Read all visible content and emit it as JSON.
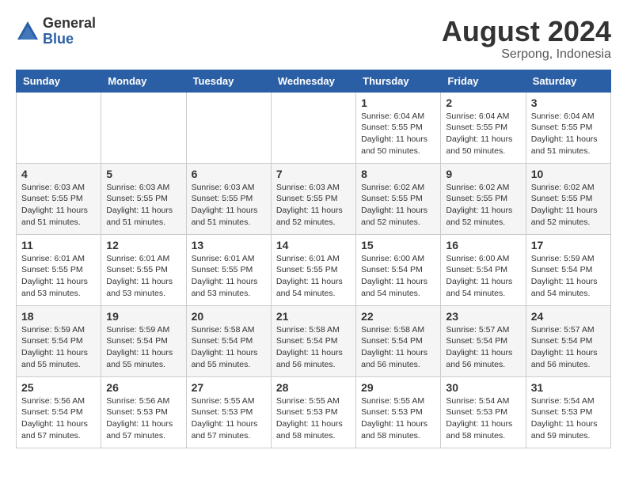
{
  "logo": {
    "general": "General",
    "blue": "Blue"
  },
  "title": {
    "month_year": "August 2024",
    "location": "Serpong, Indonesia"
  },
  "weekdays": [
    "Sunday",
    "Monday",
    "Tuesday",
    "Wednesday",
    "Thursday",
    "Friday",
    "Saturday"
  ],
  "weeks": [
    [
      {
        "day": "",
        "info": ""
      },
      {
        "day": "",
        "info": ""
      },
      {
        "day": "",
        "info": ""
      },
      {
        "day": "",
        "info": ""
      },
      {
        "day": "1",
        "info": "Sunrise: 6:04 AM\nSunset: 5:55 PM\nDaylight: 11 hours\nand 50 minutes."
      },
      {
        "day": "2",
        "info": "Sunrise: 6:04 AM\nSunset: 5:55 PM\nDaylight: 11 hours\nand 50 minutes."
      },
      {
        "day": "3",
        "info": "Sunrise: 6:04 AM\nSunset: 5:55 PM\nDaylight: 11 hours\nand 51 minutes."
      }
    ],
    [
      {
        "day": "4",
        "info": "Sunrise: 6:03 AM\nSunset: 5:55 PM\nDaylight: 11 hours\nand 51 minutes."
      },
      {
        "day": "5",
        "info": "Sunrise: 6:03 AM\nSunset: 5:55 PM\nDaylight: 11 hours\nand 51 minutes."
      },
      {
        "day": "6",
        "info": "Sunrise: 6:03 AM\nSunset: 5:55 PM\nDaylight: 11 hours\nand 51 minutes."
      },
      {
        "day": "7",
        "info": "Sunrise: 6:03 AM\nSunset: 5:55 PM\nDaylight: 11 hours\nand 52 minutes."
      },
      {
        "day": "8",
        "info": "Sunrise: 6:02 AM\nSunset: 5:55 PM\nDaylight: 11 hours\nand 52 minutes."
      },
      {
        "day": "9",
        "info": "Sunrise: 6:02 AM\nSunset: 5:55 PM\nDaylight: 11 hours\nand 52 minutes."
      },
      {
        "day": "10",
        "info": "Sunrise: 6:02 AM\nSunset: 5:55 PM\nDaylight: 11 hours\nand 52 minutes."
      }
    ],
    [
      {
        "day": "11",
        "info": "Sunrise: 6:01 AM\nSunset: 5:55 PM\nDaylight: 11 hours\nand 53 minutes."
      },
      {
        "day": "12",
        "info": "Sunrise: 6:01 AM\nSunset: 5:55 PM\nDaylight: 11 hours\nand 53 minutes."
      },
      {
        "day": "13",
        "info": "Sunrise: 6:01 AM\nSunset: 5:55 PM\nDaylight: 11 hours\nand 53 minutes."
      },
      {
        "day": "14",
        "info": "Sunrise: 6:01 AM\nSunset: 5:55 PM\nDaylight: 11 hours\nand 54 minutes."
      },
      {
        "day": "15",
        "info": "Sunrise: 6:00 AM\nSunset: 5:54 PM\nDaylight: 11 hours\nand 54 minutes."
      },
      {
        "day": "16",
        "info": "Sunrise: 6:00 AM\nSunset: 5:54 PM\nDaylight: 11 hours\nand 54 minutes."
      },
      {
        "day": "17",
        "info": "Sunrise: 5:59 AM\nSunset: 5:54 PM\nDaylight: 11 hours\nand 54 minutes."
      }
    ],
    [
      {
        "day": "18",
        "info": "Sunrise: 5:59 AM\nSunset: 5:54 PM\nDaylight: 11 hours\nand 55 minutes."
      },
      {
        "day": "19",
        "info": "Sunrise: 5:59 AM\nSunset: 5:54 PM\nDaylight: 11 hours\nand 55 minutes."
      },
      {
        "day": "20",
        "info": "Sunrise: 5:58 AM\nSunset: 5:54 PM\nDaylight: 11 hours\nand 55 minutes."
      },
      {
        "day": "21",
        "info": "Sunrise: 5:58 AM\nSunset: 5:54 PM\nDaylight: 11 hours\nand 56 minutes."
      },
      {
        "day": "22",
        "info": "Sunrise: 5:58 AM\nSunset: 5:54 PM\nDaylight: 11 hours\nand 56 minutes."
      },
      {
        "day": "23",
        "info": "Sunrise: 5:57 AM\nSunset: 5:54 PM\nDaylight: 11 hours\nand 56 minutes."
      },
      {
        "day": "24",
        "info": "Sunrise: 5:57 AM\nSunset: 5:54 PM\nDaylight: 11 hours\nand 56 minutes."
      }
    ],
    [
      {
        "day": "25",
        "info": "Sunrise: 5:56 AM\nSunset: 5:54 PM\nDaylight: 11 hours\nand 57 minutes."
      },
      {
        "day": "26",
        "info": "Sunrise: 5:56 AM\nSunset: 5:53 PM\nDaylight: 11 hours\nand 57 minutes."
      },
      {
        "day": "27",
        "info": "Sunrise: 5:55 AM\nSunset: 5:53 PM\nDaylight: 11 hours\nand 57 minutes."
      },
      {
        "day": "28",
        "info": "Sunrise: 5:55 AM\nSunset: 5:53 PM\nDaylight: 11 hours\nand 58 minutes."
      },
      {
        "day": "29",
        "info": "Sunrise: 5:55 AM\nSunset: 5:53 PM\nDaylight: 11 hours\nand 58 minutes."
      },
      {
        "day": "30",
        "info": "Sunrise: 5:54 AM\nSunset: 5:53 PM\nDaylight: 11 hours\nand 58 minutes."
      },
      {
        "day": "31",
        "info": "Sunrise: 5:54 AM\nSunset: 5:53 PM\nDaylight: 11 hours\nand 59 minutes."
      }
    ]
  ]
}
